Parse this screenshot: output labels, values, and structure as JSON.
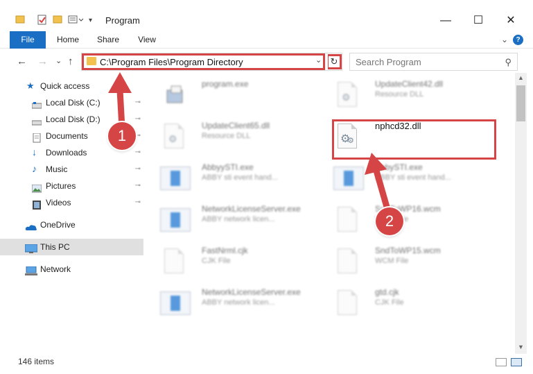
{
  "window": {
    "title": "Program",
    "minimize_glyph": "—",
    "maximize_glyph": "☐",
    "close_glyph": "✕"
  },
  "ribbon": {
    "tabs": [
      {
        "label": "File"
      },
      {
        "label": "Home"
      },
      {
        "label": "Share"
      },
      {
        "label": "View"
      }
    ],
    "expand_glyph": "⌄",
    "help_glyph": "?"
  },
  "toolbar": {
    "back_glyph": "←",
    "forward_glyph": "→",
    "recent_glyph": "⌄",
    "up_glyph": "↑",
    "address_path": "C:\\Program Files\\Program Directory",
    "address_dropdown_glyph": "⌄",
    "refresh_glyph": "↻",
    "search_placeholder": "Search Program",
    "search_glyph": "⚲"
  },
  "navpane": {
    "items": [
      {
        "label": "Quick access",
        "icon": "star-icon",
        "pinned": false
      },
      {
        "label": "Local Disk (C:)",
        "icon": "drive-icon",
        "pinned": true
      },
      {
        "label": "Local Disk (D:)",
        "icon": "drive-icon",
        "pinned": true
      },
      {
        "label": "Documents",
        "icon": "documents-icon",
        "pinned": true
      },
      {
        "label": "Downloads",
        "icon": "downloads-icon",
        "pinned": true
      },
      {
        "label": "Music",
        "icon": "music-icon",
        "pinned": true
      },
      {
        "label": "Pictures",
        "icon": "pictures-icon",
        "pinned": true
      },
      {
        "label": "Videos",
        "icon": "videos-icon",
        "pinned": true
      },
      {
        "label": "OneDrive",
        "icon": "onedrive-icon",
        "pinned": false
      },
      {
        "label": "This PC",
        "icon": "pc-icon",
        "pinned": false,
        "selected": true
      },
      {
        "label": "Network",
        "icon": "network-icon",
        "pinned": false
      }
    ],
    "pin_glyph": "📌"
  },
  "files": [
    {
      "name": "program.exe",
      "type": "",
      "icon": "exe-icon",
      "blurred": true
    },
    {
      "name": "UpdateClient42.dll",
      "type": "Resource DLL",
      "icon": "dll-icon",
      "blurred": true
    },
    {
      "name": "UpdateClient65.dll",
      "type": "Resource DLL",
      "icon": "dll-icon",
      "blurred": true
    },
    {
      "name": "nphcd32.dll",
      "type": "",
      "icon": "dll-gear-icon",
      "blurred": false
    },
    {
      "name": "AbbyySTI.exe",
      "type": "ABBY sti event hand...",
      "icon": "exe-icon",
      "blurred": true
    },
    {
      "name": "AbbySTI.exe",
      "type": "ABBY sti event hand...",
      "icon": "exe-icon",
      "blurred": true
    },
    {
      "name": "NetworkLicenseServer.exe",
      "type": "ABBY network licen...",
      "icon": "exe-icon",
      "blurred": true
    },
    {
      "name": "SndToWP16.wcm",
      "type": "WCM File",
      "icon": "file-icon",
      "blurred": true
    },
    {
      "name": "FastNrml.cjk",
      "type": "CJK File",
      "icon": "file-icon",
      "blurred": true
    },
    {
      "name": "SndToWP15.wcm",
      "type": "WCM File",
      "icon": "file-icon",
      "blurred": true
    },
    {
      "name": "NetworkLicenseServer.exe",
      "type": "ABBY network licen...",
      "icon": "exe-icon",
      "blurred": true
    },
    {
      "name": "gtd.cjk",
      "type": "CJK File",
      "icon": "file-icon",
      "blurred": true
    }
  ],
  "statusbar": {
    "item_count": "146 items"
  },
  "annotations": {
    "step1": "1",
    "step2": "2",
    "color": "#d64545"
  }
}
